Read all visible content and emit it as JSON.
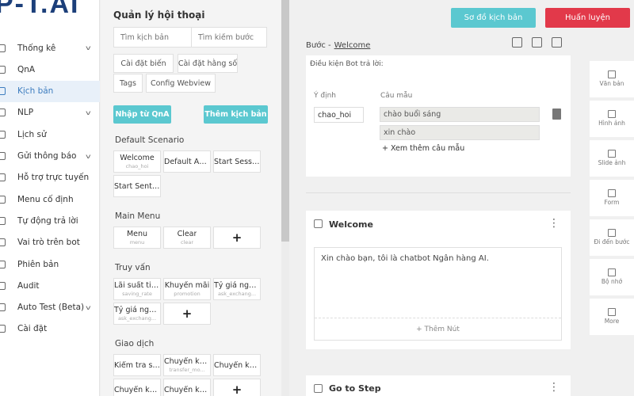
{
  "app": {
    "logo": "P-T.AI"
  },
  "nav": {
    "items": [
      {
        "label": "Thống kê",
        "chevron": true,
        "icon": "chart-icon"
      },
      {
        "label": "QnA",
        "chevron": false,
        "icon": "qna-icon"
      },
      {
        "label": "Kịch bản",
        "chevron": false,
        "icon": "script-icon",
        "active": true
      },
      {
        "label": "NLP",
        "chevron": true,
        "icon": "nlp-icon"
      },
      {
        "label": "Lịch sử",
        "chevron": false,
        "icon": "history-icon"
      },
      {
        "label": "Gửi thông báo",
        "chevron": true,
        "icon": "send-icon"
      },
      {
        "label": "Hỗ trợ trực tuyến",
        "chevron": false,
        "icon": "support-icon"
      },
      {
        "label": "Menu cố định",
        "chevron": false,
        "icon": "menu-icon"
      },
      {
        "label": "Tự động trả lời",
        "chevron": false,
        "icon": "auto-reply-icon"
      },
      {
        "label": "Vai trò trên bot",
        "chevron": false,
        "icon": "roles-icon"
      },
      {
        "label": "Phiên bản",
        "chevron": false,
        "icon": "version-icon"
      },
      {
        "label": "Audit",
        "chevron": false,
        "icon": "audit-icon"
      },
      {
        "label": "Auto Test (Beta)",
        "chevron": true,
        "icon": "test-icon"
      },
      {
        "label": "Cài đặt",
        "chevron": false,
        "icon": "settings-icon"
      }
    ]
  },
  "panel": {
    "title": "Quản lý hội thoại",
    "search_scenario_placeholder": "Tìm kịch bản",
    "search_step_placeholder": "Tìm kiếm bước",
    "chips": [
      "Cài đặt biến",
      "Cài đặt hằng số",
      "Tags",
      "Config Webview"
    ],
    "import_qna": "Nhập từ QnA",
    "add_scenario": "Thêm kịch bản",
    "groups": [
      {
        "label": "Default Scenario",
        "cards": [
          {
            "title": "Welcome",
            "sub": "chao_hoi"
          },
          {
            "title": "Default Ans...",
            "sub": ""
          },
          {
            "title": "Start Session",
            "sub": ""
          },
          {
            "title": "Start Sente...",
            "sub": ""
          }
        ]
      },
      {
        "label": "Main Menu",
        "cards": [
          {
            "title": "Menu",
            "sub": "menu"
          },
          {
            "title": "Clear",
            "sub": "clear"
          },
          {
            "title": "+",
            "sub": "",
            "plus": true
          }
        ]
      },
      {
        "label": "Truy vấn",
        "cards": [
          {
            "title": "Lãi suất tiết...",
            "sub": "saving_rate"
          },
          {
            "title": "Khuyến mãi",
            "sub": "promotion"
          },
          {
            "title": "Tỷ giá ngoại...",
            "sub": "ask_exchang..."
          },
          {
            "title": "Tỷ giá ngoại...",
            "sub": "ask_exchang..."
          },
          {
            "title": "+",
            "sub": "",
            "plus": true
          }
        ]
      },
      {
        "label": "Giao dịch",
        "cards": [
          {
            "title": "Kiểm tra số ...",
            "sub": ""
          },
          {
            "title": "Chuyển kho...",
            "sub": "transfer_mo..."
          },
          {
            "title": "Chuyển kho...",
            "sub": ""
          },
          {
            "title": "Chuyển kho...",
            "sub": ""
          },
          {
            "title": "Chuyển kho...",
            "sub": ""
          },
          {
            "title": "+",
            "sub": "",
            "plus": true
          }
        ]
      }
    ]
  },
  "topbar": {
    "diagram": "Sơ đồ kịch bản",
    "train": "Huấn luyện",
    "diagram_color": "#5bc8d0",
    "train_color": "#e2394a"
  },
  "step": {
    "prefix": "Bước -",
    "name": "Welcome",
    "condition_title": "Điều kiện Bot trả lời:",
    "intent_label": "Ý định",
    "intent_value": "chao_hoi",
    "samples_label": "Câu mẫu",
    "samples": [
      "chào buổi sáng",
      "xin chào"
    ],
    "more_samples": "+ Xem thêm câu mẫu"
  },
  "blocks": {
    "welcome_title": "Welcome",
    "welcome_message": "Xin chào bạn, tôi là chatbot Ngân hàng AI.",
    "add_button": "+ Thêm Nút",
    "goto_title": "Go to Step"
  },
  "tools": [
    {
      "label": "Văn bản",
      "icon": "text-icon"
    },
    {
      "label": "Hình ảnh",
      "icon": "image-icon"
    },
    {
      "label": "Slide ảnh",
      "icon": "slides-icon"
    },
    {
      "label": "Form",
      "icon": "form-icon"
    },
    {
      "label": "Đi đến bước",
      "icon": "goto-icon"
    },
    {
      "label": "Bộ nhớ",
      "icon": "memory-icon"
    },
    {
      "label": "More",
      "icon": "more-icon"
    }
  ]
}
